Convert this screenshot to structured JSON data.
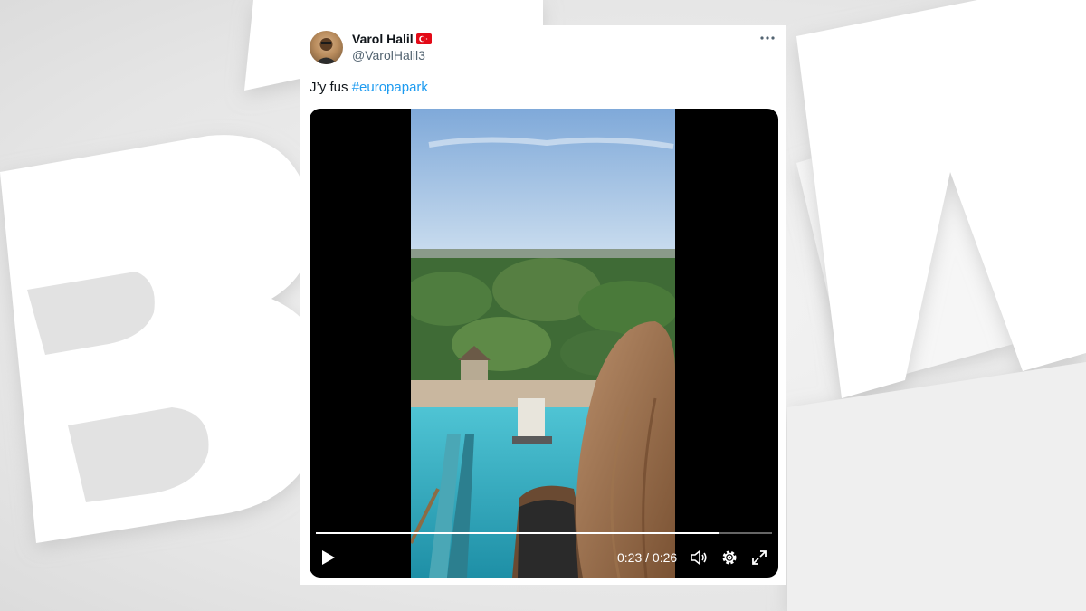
{
  "tweet": {
    "author_name": "Varol Halil",
    "flag_icon": "turkey-flag-icon",
    "handle": "@VarolHalil3",
    "more_icon": "more-horizontal-icon",
    "text_prefix": "J’y fus ",
    "hashtag": "#europapark"
  },
  "video": {
    "current_time": "0:23",
    "separator": "/",
    "duration": "0:26",
    "progress": 0.885,
    "controls": [
      "play-icon",
      "volume-icon",
      "settings-icon",
      "fullscreen-icon"
    ]
  },
  "colors": {
    "hashtag": "#1d9bf0",
    "name": "#0f1419",
    "handle": "#536471",
    "flag": "#e30a17"
  }
}
